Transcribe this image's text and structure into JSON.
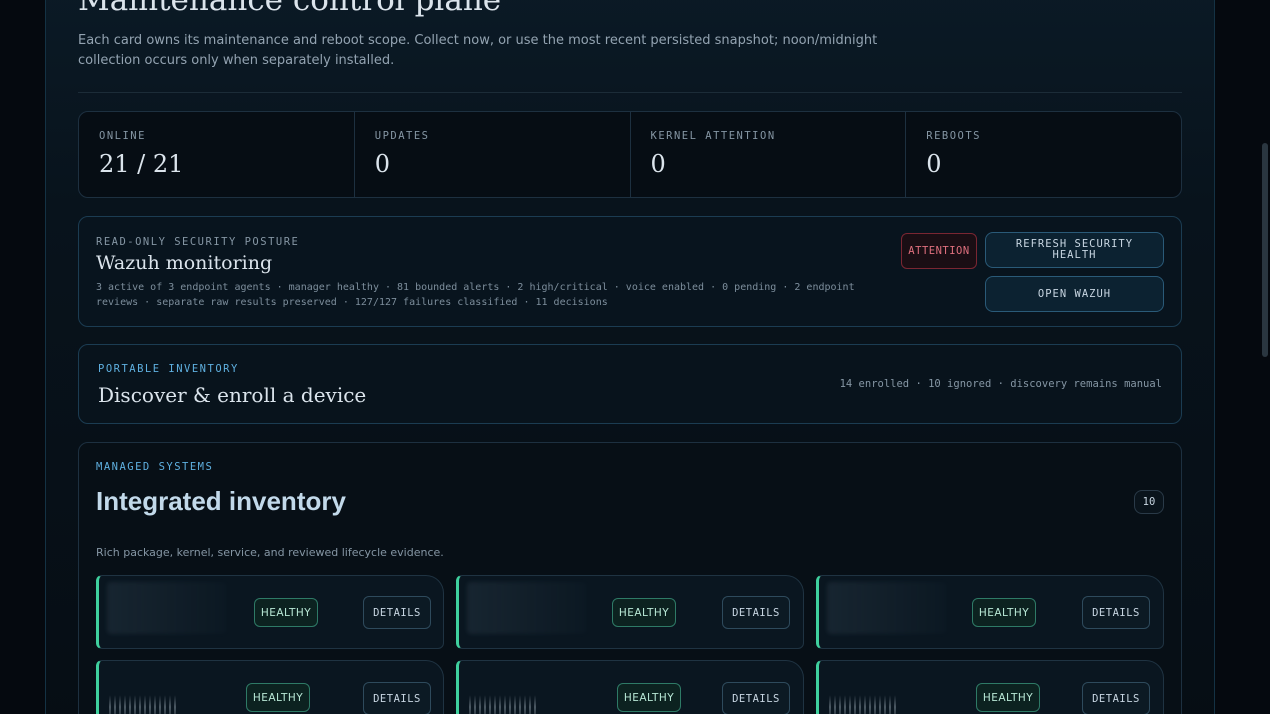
{
  "header": {
    "title": "Maintenance control plane",
    "subtitle": "Each card owns its maintenance and reboot scope. Collect now, or use the most recent persisted snapshot; noon/midnight collection occurs only when separately installed."
  },
  "stats": [
    {
      "label": "ONLINE",
      "value": "21 / 21"
    },
    {
      "label": "UPDATES",
      "value": "0"
    },
    {
      "label": "KERNEL ATTENTION",
      "value": "0"
    },
    {
      "label": "REBOOTS",
      "value": "0"
    }
  ],
  "security": {
    "kicker": "READ-ONLY SECURITY POSTURE",
    "title": "Wazuh monitoring",
    "description": "3 active of 3 endpoint agents · manager healthy · 81 bounded alerts · 2 high/critical · voice enabled · 0 pending · 2 endpoint reviews · separate raw results preserved · 127/127 failures classified · 11 decisions",
    "status_badge": "ATTENTION",
    "refresh_label": "REFRESH SECURITY HEALTH",
    "open_label": "OPEN WAZUH"
  },
  "inventory": {
    "kicker": "PORTABLE INVENTORY",
    "title": "Discover & enroll a device",
    "meta": "14 enrolled · 10 ignored · discovery remains manual"
  },
  "managed": {
    "kicker": "MANAGED SYSTEMS",
    "title": "Integrated inventory",
    "count": "10",
    "description": "Rich package, kernel, service, and reviewed lifecycle evidence.",
    "cards": [
      {
        "status": "HEALTHY",
        "details_label": "DETAILS"
      },
      {
        "status": "HEALTHY",
        "details_label": "DETAILS"
      },
      {
        "status": "HEALTHY",
        "details_label": "DETAILS"
      },
      {
        "status": "HEALTHY",
        "details_label": "DETAILS"
      },
      {
        "status": "HEALTHY",
        "details_label": "DETAILS"
      },
      {
        "status": "HEALTHY",
        "details_label": "DETAILS"
      }
    ]
  },
  "colors": {
    "accent": "#5fb0e0",
    "healthy": "#3fd09e",
    "attention": "#e0707e"
  }
}
